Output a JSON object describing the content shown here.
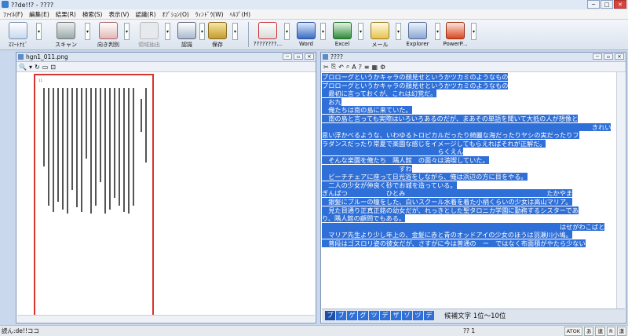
{
  "window": {
    "title": "??de!!? - ????"
  },
  "menu": [
    "ﾌｧｲﾙ(F)",
    "編集(E)",
    "結果(R)",
    "検索(S)",
    "表示(V)",
    "認識(R)",
    "ｵﾌﾟｼｮﾝ(O)",
    "ｳｨﾝﾄﾞｳ(W)",
    "ﾍﾙﾌﾟ(H)"
  ],
  "toolbar": {
    "smart": "ｽﾏｰﾄﾅﾋﾞ",
    "scan": "スキャン",
    "orientation": "向き判別",
    "area": "領域抽出",
    "recognize": "認識",
    "save": "保存",
    "export_app": "????????...",
    "word": "Word",
    "excel": "Excel",
    "mail": "メール",
    "explorer": "Explorer",
    "powerpoint": "PowerP..."
  },
  "image_pane": {
    "title": "hgn1_011.png",
    "scanner_note": "11"
  },
  "text_pane": {
    "title": "????",
    "lines": [
      "プロローグというかキャラの顔見せというかツカミのようなもの",
      "プロローグというかキャラの顔見せというかツカミのようなもの",
      "　最初に言っておくが、これは幻覚だ。",
      "",
      "　お九",
      "　俺たちは南の島に来ていた。",
      "　南の島と言っても実際はいろいろあるのだが、まあその単語を聞いて大抵の人が想像と",
      "　　　　　　　　　　　　　　　　　　　　　　　　　　　　　　　　　　　　　　　　　　きれい",
      "思い浮かべるような、いわゆるトロピカルだったり綺麗な海だったりヤシの実だったりフ",
      "ラダンスだったり常夏で楽園な感じをイメージしてもらえればそれが正解だ。",
      "　　　　　　　　　　　　　　　　　　らくえん",
      "　そんな楽園を俺たち　隅人館　の面々は満喫していた。",
      "　　　　　　　　　　　　すわ",
      "　ビーチチェアに座って日光浴をしながら、俺は浜辺の方に目をやる。",
      "　二人の少女が仲良く砂でお城を造っている。",
      "ぎんぱつ　　　　　　ひとみ　　　　　　　　　　　　　　　　　　　　　　たかやま",
      "　銀髪にブルーの瞳をした、白いスクール水着を着た小柄くらいの少女は高山マリア。",
      "　見た目通り正真正銘の幼女だが、れっきとした聖タロニカ学園に勤務するシスターであ",
      "り、隅人館の顧問でもある。",
      "　　　　　　　　　　　　　　　　　　　　　　　　　　　　　　　　　　　　　はせがわこばと",
      "　マリア先生より少し年上の、金髪に赤と青のオッドアイの少女のほうは羽瀬川小鳩。",
      "　普段はゴスロリ姿の彼女だが、さすがに今は普通の　ー　ではなく布面積がやたら少ない"
    ]
  },
  "candidates": {
    "chars": [
      "プ",
      "ブ",
      "ゲ",
      "グ",
      "ツ",
      "デ",
      "ザ",
      "ゾ",
      "ヅ",
      "デ"
    ],
    "info": "候補文字 1位〜10位"
  },
  "status": {
    "left": "読ん:de!!ココ",
    "mid": "?? 1"
  },
  "ime": [
    "ATOK",
    "あ",
    "連",
    "R",
    "漢"
  ],
  "colors": {
    "selection": "#2f6fd8",
    "page_border": "#d8342f"
  }
}
